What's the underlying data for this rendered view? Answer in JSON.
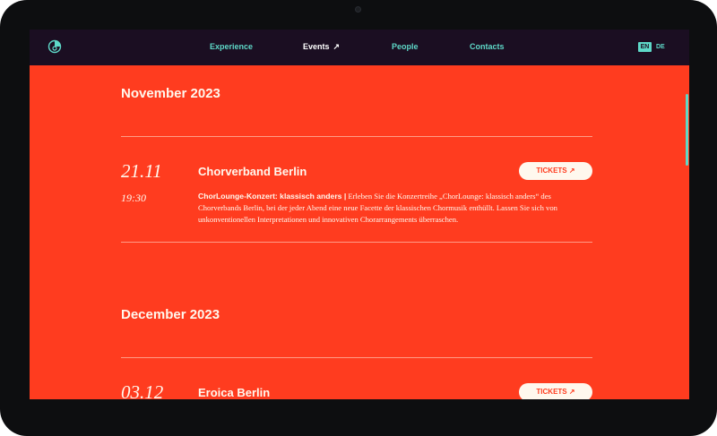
{
  "nav": {
    "items": [
      {
        "label": "Experience"
      },
      {
        "label": "Events",
        "arrow": "↗"
      },
      {
        "label": "People"
      },
      {
        "label": "Contacts"
      }
    ],
    "lang_en": "EN",
    "lang_de": "DE"
  },
  "sections": [
    {
      "month": "November 2023",
      "event": {
        "date": "21.11",
        "time": "19:30",
        "title": "Chorverband Berlin",
        "ticket_label": "TICKETS ↗",
        "desc_bold": "ChorLounge-Konzert: klassisch anders |",
        "desc_text": " Erleben Sie die Konzertreihe „ChorLounge: klassisch anders“ des Chorverbands Berlin, bei der jeder Abend eine neue Facette der klassischen Chormusik enthüllt. Lassen Sie sich von unkonventionellen Interpretationen und innovativen Chorarrangements überraschen."
      }
    },
    {
      "month": "December 2023",
      "event": {
        "date": "03.12",
        "title": "Eroica Berlin",
        "ticket_label": "TICKETS ↗"
      }
    }
  ],
  "colors": {
    "background": "#ff3c1f",
    "nav": "#1b0e22",
    "accent": "#5ed8c8",
    "text": "#fff8ee"
  },
  "icons": [
    "logo-icon",
    "arrow-up-right-icon"
  ]
}
